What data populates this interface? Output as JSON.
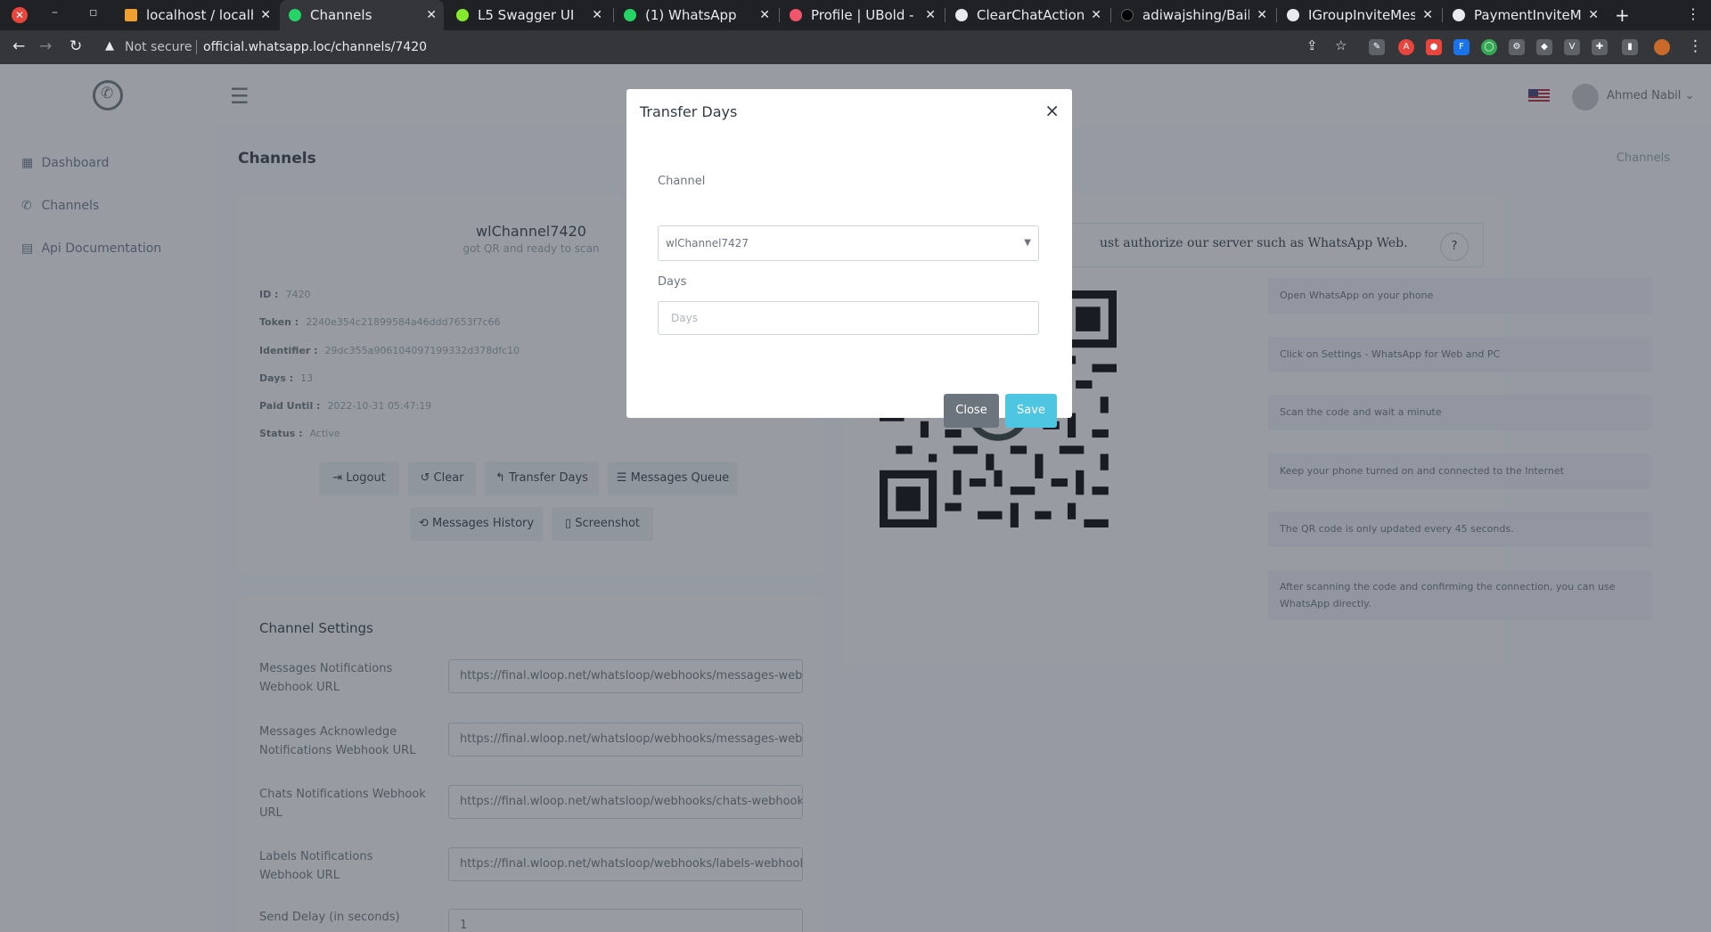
{
  "browser": {
    "tabs": [
      {
        "title": "localhost / localhost",
        "icon": "database-icon",
        "active": false
      },
      {
        "title": "Channels",
        "icon": "whatsapp-icon",
        "active": true
      },
      {
        "title": "L5 Swagger UI",
        "icon": "swagger-icon",
        "active": false
      },
      {
        "title": "(1) WhatsApp",
        "icon": "whatsapp-icon",
        "active": false
      },
      {
        "title": "Profile | UBold - Re",
        "icon": "ubold-icon",
        "active": false
      },
      {
        "title": "ClearChatAction | ",
        "icon": "globe-icon",
        "active": false
      },
      {
        "title": "adiwajshing/Baile",
        "icon": "github-icon",
        "active": false
      },
      {
        "title": "IGroupInviteMess",
        "icon": "globe-icon",
        "active": false
      },
      {
        "title": "PaymentInviteMe",
        "icon": "globe-icon",
        "active": false
      }
    ],
    "security_label": "Not secure",
    "url": "official.whatsapp.loc/channels/7420"
  },
  "sidebar": {
    "items": [
      {
        "label": "Dashboard",
        "icon": "dashboard-icon"
      },
      {
        "label": "Channels",
        "icon": "whatsapp-icon"
      },
      {
        "label": "Api Documentation",
        "icon": "document-icon"
      }
    ]
  },
  "topbar": {
    "user_name": "Ahmed Nabil"
  },
  "main": {
    "page_title": "Channels",
    "breadcrumb": "Channels",
    "channel": {
      "name": "wlChannel7420",
      "subtitle": "got QR and ready to scan",
      "fields": [
        {
          "label": "ID :",
          "value": "7420"
        },
        {
          "label": "Token :",
          "value": "2240e354c21899584a46ddd7653f7c66"
        },
        {
          "label": "Identifier :",
          "value": "29dc355a906104097199332d378dfc10"
        },
        {
          "label": "Days :",
          "value": "13"
        },
        {
          "label": "Paid Until :",
          "value": "2022-10-31 05:47:19"
        },
        {
          "label": "Status :",
          "value": "Active"
        }
      ],
      "buttons": {
        "logout": "Logout",
        "clear": "Clear",
        "transfer_days": "Transfer Days",
        "messages_queue": "Messages Queue",
        "messages_history": "Messages History",
        "screenshot": "Screenshot"
      }
    },
    "settings": {
      "title": "Channel Settings",
      "rows": [
        {
          "label": "Messages Notifications Webhook URL",
          "value": "https://final.wloop.net/whatsloop/webhooks/messages-webhook"
        },
        {
          "label": "Messages Acknowledge Notifications Webhook URL",
          "value": "https://final.wloop.net/whatsloop/webhooks/messages-webhook"
        },
        {
          "label": "Chats Notifications Webhook URL",
          "value": "https://final.wloop.net/whatsloop/webhooks/chats-webhook"
        },
        {
          "label": "Labels Notifications Webhook URL",
          "value": "https://final.wloop.net/whatsloop/webhooks/labels-webhook"
        },
        {
          "label": "Send Delay (in seconds)",
          "value": "1"
        }
      ]
    },
    "auth": {
      "text": "ust authorize our server such as WhatsApp Web.",
      "help": "?",
      "steps": [
        "Open WhatsApp on your phone",
        "Click on Settings - WhatsApp for Web and PC",
        "Scan the code and wait a minute",
        "Keep your phone turned on and connected to the Internet",
        "The QR code is only updated every 45 seconds.",
        "After scanning the code and confirming the connection, you can use WhatsApp directly."
      ]
    }
  },
  "modal": {
    "title": "Transfer Days",
    "close_symbol": "×",
    "channel_label": "Channel",
    "channel_value": "wlChannel7427",
    "days_label": "Days",
    "days_placeholder": "Days",
    "close_button": "Close",
    "save_button": "Save"
  },
  "colors": {
    "sidebar_bg": "#ffffff",
    "page_bg": "#fafbfe",
    "save_button": "#4fc6e1",
    "close_button": "#6c757d",
    "browser_chrome": "#202124"
  }
}
